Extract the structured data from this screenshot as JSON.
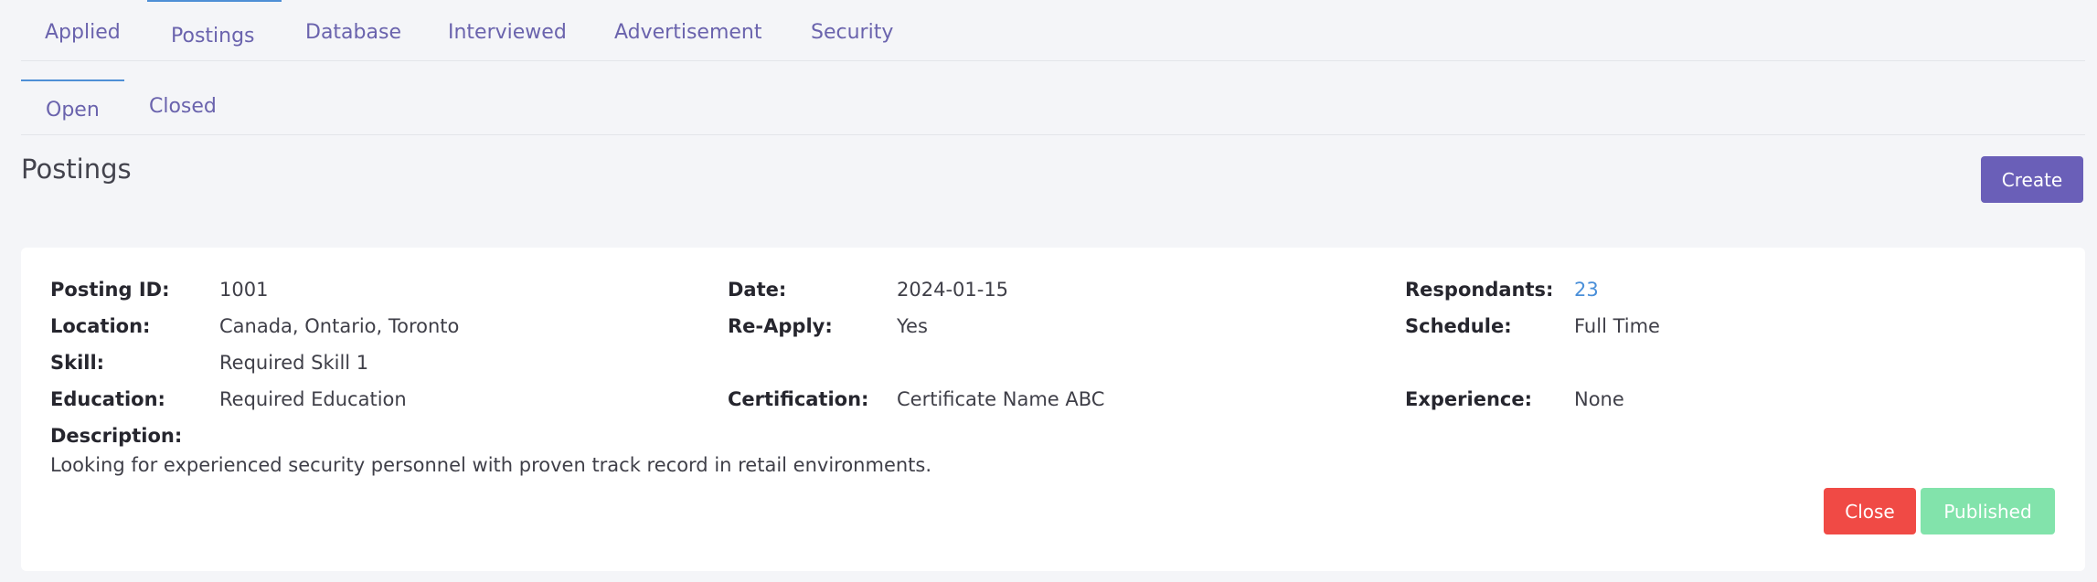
{
  "tabs": [
    {
      "label": "Applied"
    },
    {
      "label": "Postings"
    },
    {
      "label": "Database"
    },
    {
      "label": "Interviewed"
    },
    {
      "label": "Advertisement"
    },
    {
      "label": "Security"
    }
  ],
  "active_tab": "Postings",
  "subtabs": [
    {
      "label": "Open"
    },
    {
      "label": "Closed"
    }
  ],
  "active_subtab": "Open",
  "page": {
    "title": "Postings",
    "create_label": "Create"
  },
  "posting": {
    "fields": {
      "posting_id": {
        "label": "Posting ID:",
        "value": "1001"
      },
      "location": {
        "label": "Location:",
        "value": "Canada, Ontario, Toronto"
      },
      "skill": {
        "label": "Skill:",
        "value": "Required Skill 1"
      },
      "education": {
        "label": "Education:",
        "value": "Required Education"
      },
      "date": {
        "label": "Date:",
        "value": "2024-01-15"
      },
      "reapply": {
        "label": "Re-Apply:",
        "value": "Yes"
      },
      "certification": {
        "label": "Certification:",
        "value": "Certificate Name ABC"
      },
      "respondants": {
        "label": "Respondants:",
        "value": "23"
      },
      "schedule": {
        "label": "Schedule:",
        "value": "Full Time"
      },
      "experience": {
        "label": "Experience:",
        "value": "None"
      }
    },
    "description_label": "Description:",
    "description": "Looking for experienced security personnel with proven track record in retail environments.",
    "close_label": "Close",
    "published_label": "Published"
  },
  "colors": {
    "accent": "#6a5fb8",
    "tab_text": "#6a63ad",
    "active_indicator": "#4e8fd6",
    "close": "#f04a45",
    "published": "#82e3ab",
    "link": "#4a8fd9"
  }
}
